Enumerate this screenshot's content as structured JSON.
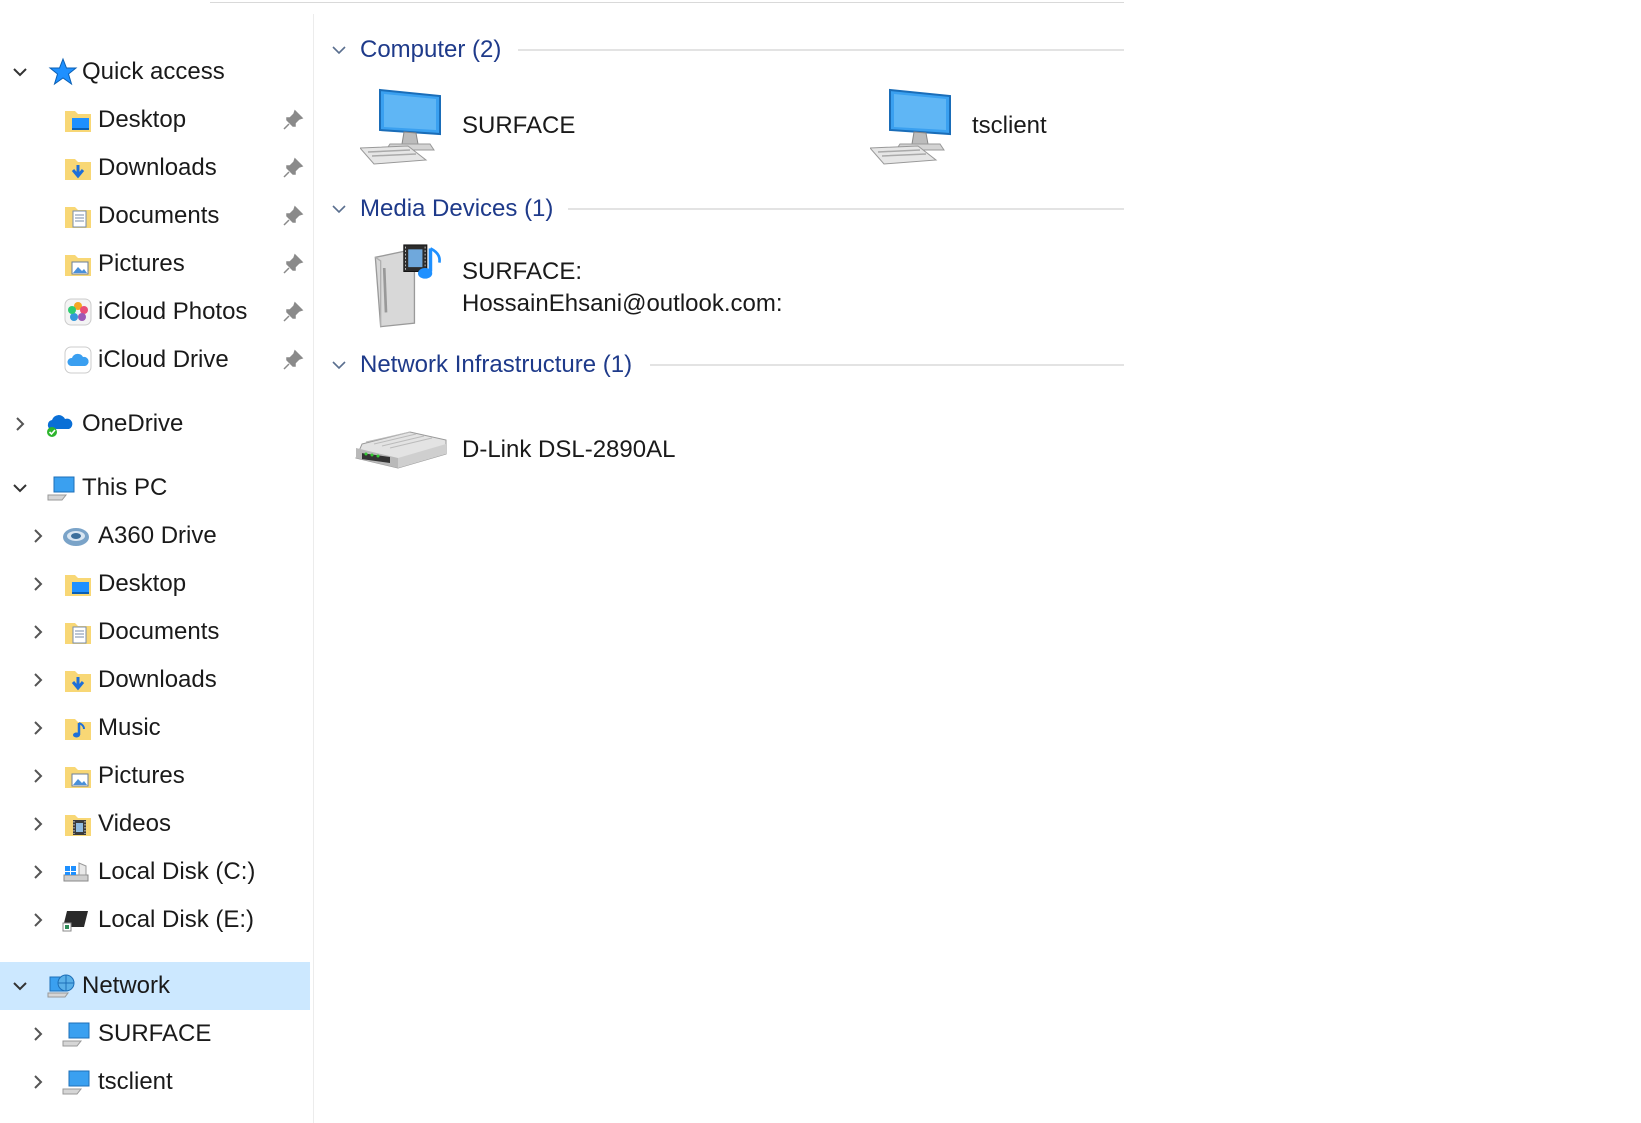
{
  "sidebar": {
    "quick_access": {
      "label": "Quick access",
      "icon": "star-icon",
      "items": [
        {
          "label": "Desktop",
          "icon": "desktop-folder-icon",
          "pinned": true
        },
        {
          "label": "Downloads",
          "icon": "downloads-folder-icon",
          "pinned": true
        },
        {
          "label": "Documents",
          "icon": "documents-folder-icon",
          "pinned": true
        },
        {
          "label": "Pictures",
          "icon": "pictures-folder-icon",
          "pinned": true
        },
        {
          "label": "iCloud Photos",
          "icon": "icloud-photos-icon",
          "pinned": true
        },
        {
          "label": "iCloud Drive",
          "icon": "icloud-drive-icon",
          "pinned": true
        }
      ]
    },
    "onedrive": {
      "label": "OneDrive",
      "icon": "onedrive-icon"
    },
    "this_pc": {
      "label": "This PC",
      "icon": "computer-icon",
      "items": [
        {
          "label": "A360 Drive",
          "icon": "a360-drive-icon"
        },
        {
          "label": "Desktop",
          "icon": "desktop-folder-icon"
        },
        {
          "label": "Documents",
          "icon": "documents-folder-icon"
        },
        {
          "label": "Downloads",
          "icon": "downloads-folder-icon"
        },
        {
          "label": "Music",
          "icon": "music-folder-icon"
        },
        {
          "label": "Pictures",
          "icon": "pictures-folder-icon"
        },
        {
          "label": "Videos",
          "icon": "videos-folder-icon"
        },
        {
          "label": "Local Disk (C:)",
          "icon": "windows-drive-icon"
        },
        {
          "label": "Local Disk (E:)",
          "icon": "drive-icon"
        }
      ]
    },
    "network": {
      "label": "Network",
      "icon": "network-icon",
      "selected": true,
      "items": [
        {
          "label": "SURFACE",
          "icon": "computer-icon"
        },
        {
          "label": "tsclient",
          "icon": "computer-icon"
        }
      ]
    }
  },
  "main": {
    "groups": [
      {
        "title": "Computer (2)",
        "items": [
          {
            "label": "SURFACE",
            "icon": "computer-icon"
          },
          {
            "label": "tsclient",
            "icon": "computer-icon"
          }
        ]
      },
      {
        "title": "Media Devices (1)",
        "items": [
          {
            "label_line1": "SURFACE:",
            "label_line2": "HossainEhsani@outlook.com:",
            "icon": "media-server-icon"
          }
        ]
      },
      {
        "title": "Network Infrastructure (1)",
        "items": [
          {
            "label": "D-Link DSL-2890AL",
            "icon": "router-icon"
          }
        ]
      }
    ]
  },
  "colors": {
    "selection": "#cce8ff",
    "group_title": "#1e3a8a",
    "folder": "#f8d775",
    "accent": "#1e90ff"
  }
}
